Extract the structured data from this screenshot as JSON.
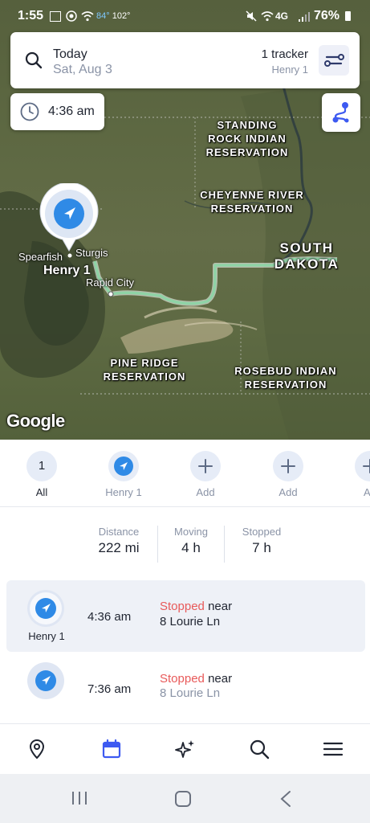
{
  "status_bar": {
    "time": "1:55",
    "temp_value": "84°",
    "temp_extra": "102°",
    "network": "4G",
    "battery": "76%"
  },
  "header": {
    "day": "Today",
    "date": "Sat, Aug 3",
    "tracker_count": "1 tracker",
    "tracker_name": "Henry 1"
  },
  "time_chip": "4:36 am",
  "map": {
    "labels": {
      "standing_rock": "STANDING\nROCK INDIAN\nRESERVATION",
      "cheyenne": "CHEYENNE RIVER\nRESERVATION",
      "south_dakota": "SOUTH\nDAKOTA",
      "pine_ridge": "PINE RIDGE\nRESERVATION",
      "rosebud": "ROSEBUD INDIAN\nRESERVATION"
    },
    "cities": {
      "spearfish": "Spearfish",
      "sturgis": "Sturgis",
      "rapid_city": "Rapid City"
    },
    "marker_label": "Henry 1",
    "attribution": "Google"
  },
  "strip": [
    {
      "num": "1",
      "label": "All"
    },
    {
      "label": "Henry 1"
    },
    {
      "label": "Add"
    },
    {
      "label": "Add"
    },
    {
      "label": "Ad"
    }
  ],
  "stats": [
    {
      "label": "Distance",
      "value": "222 mi"
    },
    {
      "label": "Moving",
      "value": "4 h"
    },
    {
      "label": "Stopped",
      "value": "7 h"
    }
  ],
  "stops": [
    {
      "avatar_name": "Henry 1",
      "time": "4:36 am",
      "status": "Stopped",
      "near": "near",
      "address": "8 Lourie Ln"
    },
    {
      "time": "7:36 am",
      "status": "Stopped",
      "near": "near",
      "address": "8 Lourie Ln"
    }
  ],
  "colors": {
    "accent": "#3d5af1",
    "blue_marker": "#2f8ae6",
    "stopped": "#e85a5a",
    "route": "#8fd3a6"
  }
}
